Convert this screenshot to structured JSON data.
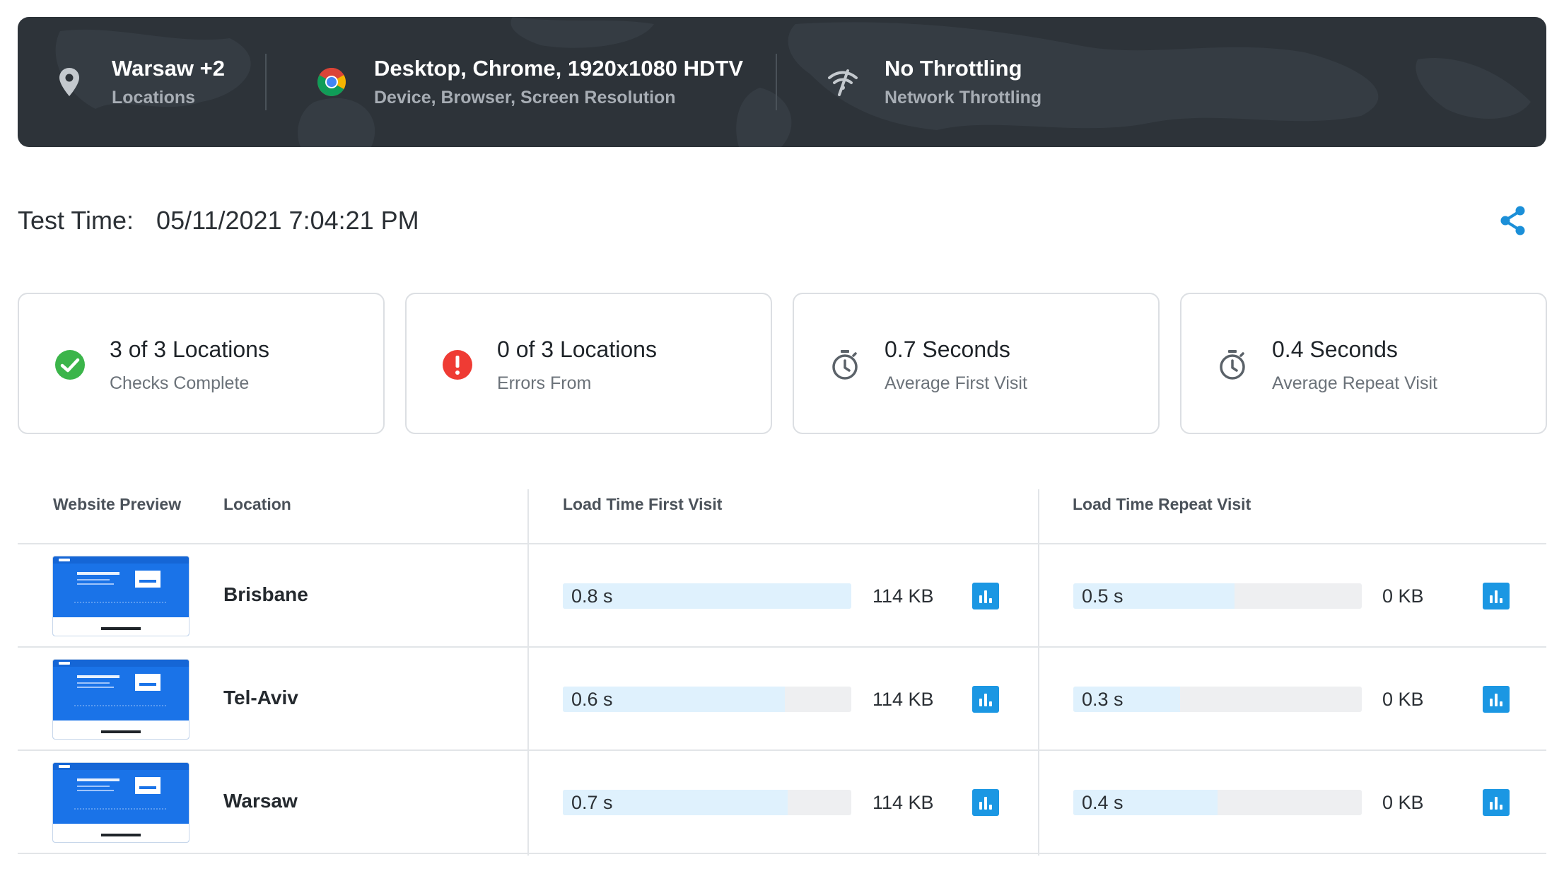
{
  "banner": {
    "location": {
      "title": "Warsaw +2",
      "subtitle": "Locations",
      "icon": "map-pin-icon"
    },
    "device": {
      "title": "Desktop, Chrome, 1920x1080 HDTV",
      "subtitle": "Device, Browser, Screen Resolution",
      "icon": "chrome-icon"
    },
    "network": {
      "title": "No Throttling",
      "subtitle": "Network Throttling",
      "icon": "signal-off-icon"
    }
  },
  "test_time": {
    "label": "Test Time:",
    "value": "05/11/2021 7:04:21 PM"
  },
  "share_icon": "share-icon",
  "cards": [
    {
      "title": "3 of 3 Locations",
      "subtitle": "Checks Complete",
      "icon": "check-circle-icon",
      "color": "#3bb54a"
    },
    {
      "title": "0 of 3 Locations",
      "subtitle": "Errors From",
      "icon": "error-circle-icon",
      "color": "#ef3b34"
    },
    {
      "title": "0.7 Seconds",
      "subtitle": "Average First Visit",
      "icon": "stopwatch-icon",
      "color": "#5b6269"
    },
    {
      "title": "0.4 Seconds",
      "subtitle": "Average Repeat Visit",
      "icon": "stopwatch-icon",
      "color": "#5b6269"
    }
  ],
  "table": {
    "headers": {
      "preview": "Website Preview",
      "location": "Location",
      "first": "Load Time First Visit",
      "repeat": "Load Time Repeat Visit"
    },
    "rows": [
      {
        "location": "Brisbane",
        "first_time": "0.8 s",
        "first_fill": 1.0,
        "first_size": "114 KB",
        "repeat_time": "0.5 s",
        "repeat_fill": 0.56,
        "repeat_size": "0 KB"
      },
      {
        "location": "Tel-Aviv",
        "first_time": "0.6 s",
        "first_fill": 0.77,
        "first_size": "114 KB",
        "repeat_time": "0.3 s",
        "repeat_fill": 0.37,
        "repeat_size": "0 KB"
      },
      {
        "location": "Warsaw",
        "first_time": "0.7 s",
        "first_fill": 0.78,
        "first_size": "114 KB",
        "repeat_time": "0.4 s",
        "repeat_fill": 0.5,
        "repeat_size": "0 KB"
      }
    ]
  },
  "colors": {
    "accent": "#1b97e3",
    "bar_fill": "#dff1fd",
    "bar_track": "#eeeff1",
    "banner_bg": "#2d3339"
  }
}
